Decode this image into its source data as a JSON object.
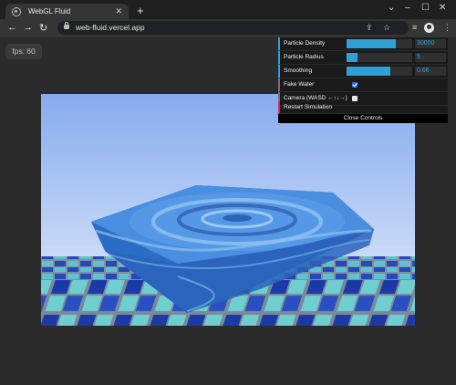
{
  "browser": {
    "tab_title": "WebGL Fluid",
    "tab_close": "✕",
    "new_tab": "+",
    "win_minimize": "–",
    "win_maximize": "☐",
    "win_close": "✕",
    "back": "←",
    "forward": "→",
    "reload": "↻",
    "url": "web-fluid.vercel.app",
    "share_icon": "⇪",
    "bookmark_icon": "☆",
    "tablist_icon": "≡",
    "menu_icon": "⋮"
  },
  "page": {
    "fps": "fps: 60"
  },
  "controls": {
    "particle_density": {
      "label": "Particle Density",
      "value": "30000",
      "fill": 0.75
    },
    "particle_radius": {
      "label": "Particle Radius",
      "value": "5",
      "fill": 0.16
    },
    "smoothing": {
      "label": "Smoothing",
      "value": "0.66",
      "fill": 0.66
    },
    "fake_water": {
      "label": "Fake Water",
      "checked": true
    },
    "camera": {
      "label": "Camera (WASD ←↑↓→)",
      "checked": false
    },
    "restart": {
      "label": "Restart Simulation"
    },
    "close": {
      "label": "Close Controls"
    }
  },
  "colors": {
    "accent": "#2fa1d6",
    "sky_top": "#87aef0",
    "sky_bottom": "#dfe9f9",
    "water": "#3a7dd0",
    "tile_blue": "#1c3aa6",
    "tile_cyan": "#6fcfd0"
  }
}
